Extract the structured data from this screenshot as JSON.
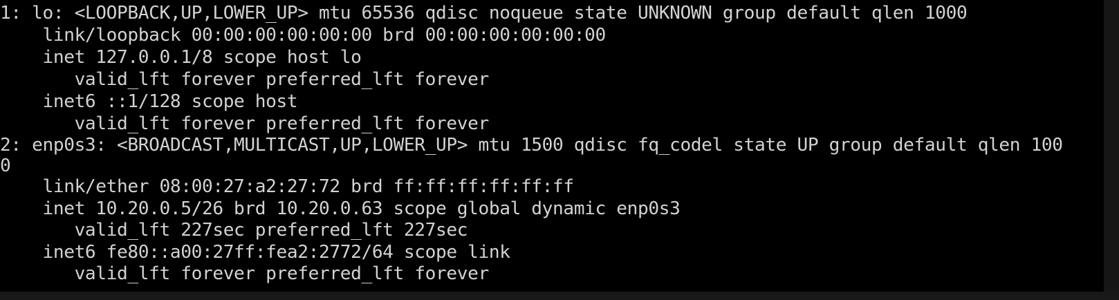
{
  "terminal": {
    "lines": [
      "1: lo: <LOOPBACK,UP,LOWER_UP> mtu 65536 qdisc noqueue state UNKNOWN group default qlen 1000",
      "    link/loopback 00:00:00:00:00:00 brd 00:00:00:00:00:00",
      "    inet 127.0.0.1/8 scope host lo",
      "       valid_lft forever preferred_lft forever",
      "    inet6 ::1/128 scope host",
      "       valid_lft forever preferred_lft forever",
      "2: enp0s3: <BROADCAST,MULTICAST,UP,LOWER_UP> mtu 1500 qdisc fq_codel state UP group default qlen 100",
      "0",
      "    link/ether 08:00:27:a2:27:72 brd ff:ff:ff:ff:ff:ff",
      "    inet 10.20.0.5/26 brd 10.20.0.63 scope global dynamic enp0s3",
      "       valid_lft 227sec preferred_lft 227sec",
      "    inet6 fe80::a00:27ff:fea2:2772/64 scope link",
      "       valid_lft forever preferred_lft forever"
    ]
  },
  "colors": {
    "background": "#000000",
    "foreground": "#d2d2d2"
  }
}
